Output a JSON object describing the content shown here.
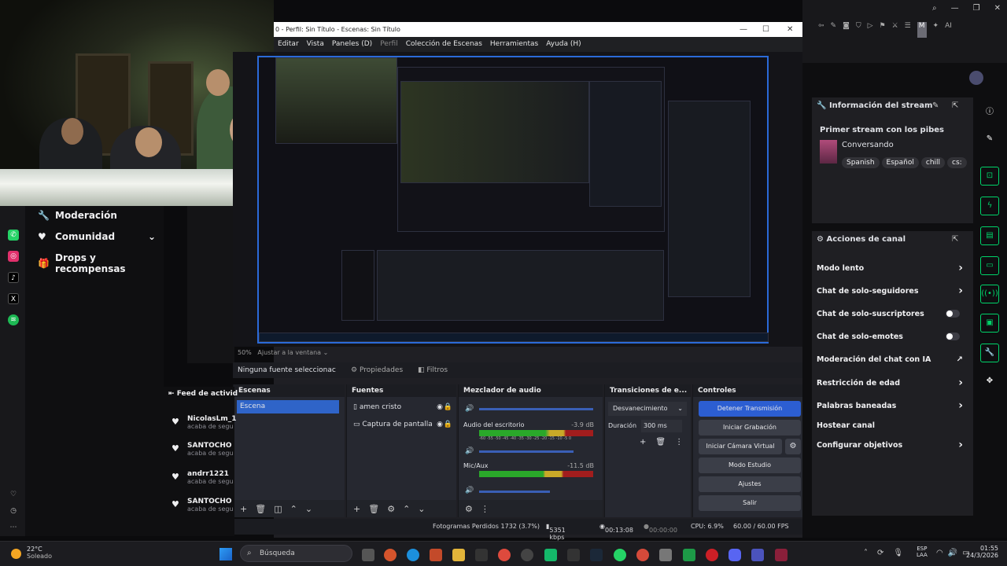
{
  "obs": {
    "title": "0 - Perfil: Sin Título - Escenas: Sin Título",
    "menu": [
      "Editar",
      "Vista",
      "Paneles (D)",
      "Perfil",
      "Colección de Escenas",
      "Herramientas",
      "Ayuda (H)"
    ],
    "zoom": "50%",
    "fit": "Ajustar a la ventana",
    "no_source": "Ninguna fuente seleccionac",
    "props": "Propiedades",
    "filters": "Filtros",
    "docks": {
      "scenes": "Escenas",
      "sources": "Fuentes",
      "mixer": "Mezclador de audio",
      "transitions": "Transiciones de e...",
      "controls": "Controles"
    },
    "scene": "Escena",
    "sources": [
      "amen cristo",
      "Captura de pantalla"
    ],
    "audio": [
      {
        "name": "Audio del escritorio",
        "db": "-3.9 dB"
      },
      {
        "name": "Mic/Aux",
        "db": "-11.5 dB"
      }
    ],
    "meter_scale": "-60 -55 -50 -45 -40 -35 -30 -25 -20 -15 -10 -5 0",
    "transition": "Desvanecimiento",
    "duration_label": "Duración",
    "duration": "300 ms",
    "controls": [
      "Detener Transmisión",
      "Iniciar Grabación",
      "Iniciar Cámara Virtual",
      "Modo Estudio",
      "Ajustes",
      "Salir"
    ],
    "status": {
      "dropped": "Fotogramas Perdidos 1732 (3.7%)",
      "kbps": "5351 kbps",
      "live": "00:13:08",
      "rec": "00:00:00",
      "cpu": "CPU: 6.9%",
      "fps": "60.00 / 60.00 FPS"
    }
  },
  "left_menu": [
    "Moderación",
    "Comunidad",
    "Drops y recompensas"
  ],
  "feed": {
    "title": "Feed de activid",
    "items": [
      {
        "name": "NicolasLm_1",
        "sub": "acaba de segu"
      },
      {
        "name": "SANTOCHO",
        "sub": "acaba de segu"
      },
      {
        "name": "andrr1221",
        "sub": "acaba de segu"
      },
      {
        "name": "SANTOCHO",
        "sub": "acaba de segu"
      }
    ]
  },
  "stream_info": {
    "header": "Información del stream",
    "title": "Primer stream con los pibes",
    "category": "Conversando",
    "tags": [
      "Spanish",
      "Español",
      "chill",
      "cs:"
    ]
  },
  "channel_actions": {
    "header": "Acciones de canal",
    "items": [
      {
        "label": "Modo lento",
        "kind": "chev"
      },
      {
        "label": "Chat de solo-seguidores",
        "kind": "chev"
      },
      {
        "label": "Chat de solo-suscriptores",
        "kind": "toggle"
      },
      {
        "label": "Chat de solo-emotes",
        "kind": "toggle"
      },
      {
        "label": "Moderación del chat con IA",
        "kind": "ext"
      },
      {
        "label": "Restricción de edad",
        "kind": "chev"
      },
      {
        "label": "Palabras baneadas",
        "kind": "chev"
      },
      {
        "label": "Hostear canal",
        "kind": "none"
      },
      {
        "label": "Configurar objetivos",
        "kind": "chev"
      }
    ]
  },
  "taskbar": {
    "weather_temp": "22°C",
    "weather_desc": "Soleado",
    "search": "Búsqueda",
    "lang1": "ESP",
    "lang2": "LAA",
    "time": "01:55",
    "date": "24/3/2026"
  }
}
